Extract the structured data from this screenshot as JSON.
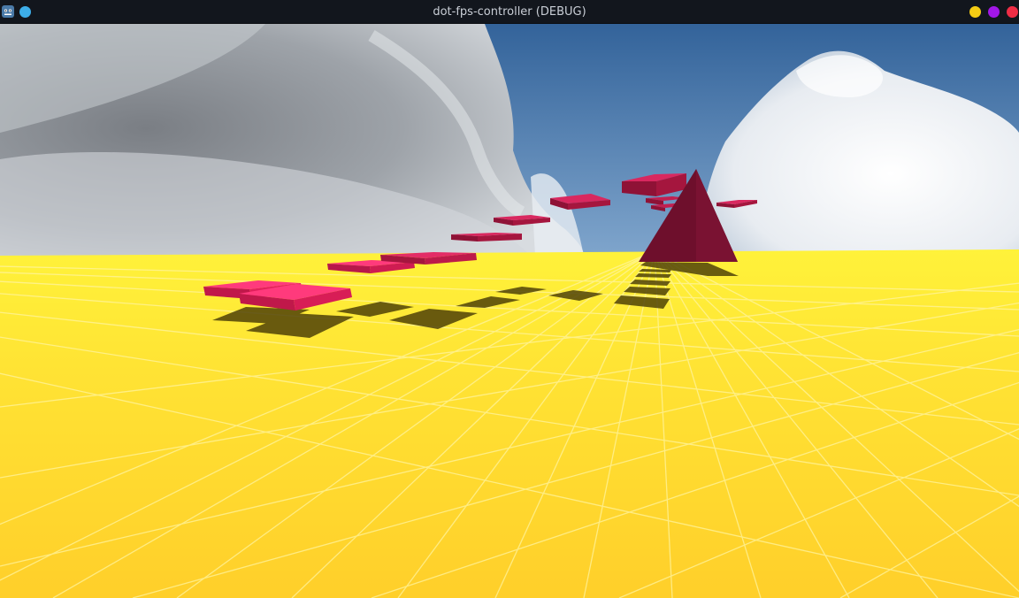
{
  "window": {
    "title": "dot-fps-controller (DEBUG)"
  },
  "titlebar": {
    "app_icon": "godot-icon",
    "pin_icon": "pin-icon",
    "buttons": [
      {
        "name": "minimize-button",
        "color": "#f4cc14"
      },
      {
        "name": "maximize-button",
        "color": "#a217e8"
      },
      {
        "name": "close-button",
        "color": "#ef2d45"
      }
    ]
  },
  "scene": {
    "sky_color": "#3f6fa3",
    "floor_color": "#ffd82b",
    "grid_color": "#fff27a",
    "platform_color": "#ff2d6e",
    "far_platform_color": "#a8183e",
    "pyramid_color": "#6e0f2c",
    "shadow_color": "#4a3d08"
  }
}
